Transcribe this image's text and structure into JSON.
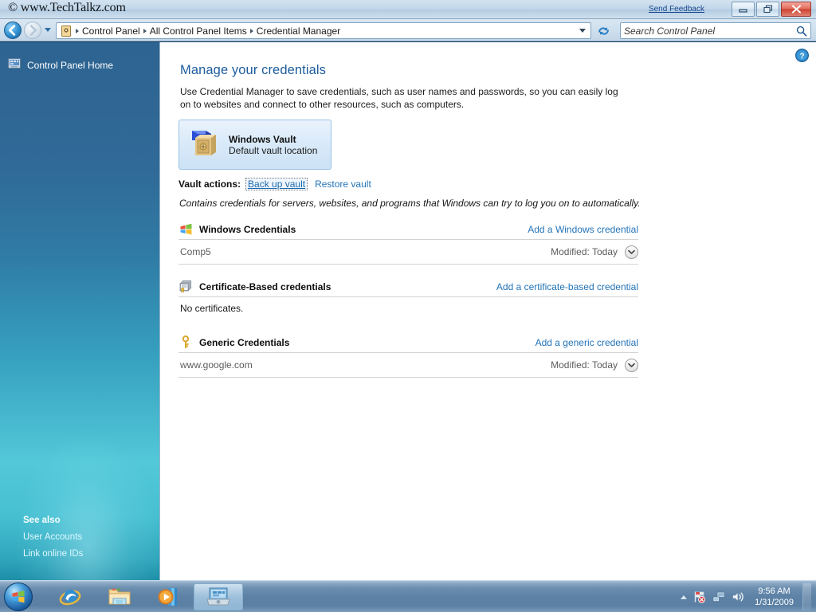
{
  "titlebar": {
    "watermark": "© www.TechTalkz.com",
    "feedback_label": "Send Feedback",
    "minimize_label": "Minimize",
    "restore_label": "Restore Down",
    "close_label": "Close"
  },
  "navbar": {
    "back_label": "Back",
    "forward_label": "Forward",
    "recent_pages_label": "Recent pages",
    "breadcrumbs": [
      {
        "label": "Control Panel"
      },
      {
        "label": "All Control Panel Items"
      },
      {
        "label": "Credential Manager"
      }
    ],
    "address_dropdown_label": "Previous locations",
    "refresh_label": "Refresh",
    "search_placeholder": "Search Control Panel",
    "search_value": ""
  },
  "sidebar": {
    "home_label": "Control Panel Home",
    "see_also_title": "See also",
    "see_also_links": [
      {
        "label": "User Accounts"
      },
      {
        "label": "Link online IDs"
      }
    ]
  },
  "content": {
    "help_label": "Help",
    "title": "Manage your credentials",
    "description": "Use Credential Manager to save credentials, such as user names and passwords, so you can easily log on to websites and connect to other resources, such as computers.",
    "vault": {
      "name": "Windows Vault",
      "subtitle": "Default vault location",
      "actions_label": "Vault actions:",
      "backup_label": "Back up vault",
      "restore_label": "Restore vault",
      "note": "Contains credentials for servers, websites, and programs that Windows can try to log you on to automatically."
    },
    "sections": [
      {
        "icon": "windows-flag-icon",
        "title": "Windows Credentials",
        "action": "Add a Windows credential",
        "rows": [
          {
            "name": "Comp5",
            "modified_label": "Modified:",
            "modified_value": "Today"
          }
        ],
        "empty_text": ""
      },
      {
        "icon": "certificate-icon",
        "title": "Certificate-Based credentials",
        "action": "Add a certificate-based credential",
        "rows": [],
        "empty_text": "No certificates."
      },
      {
        "icon": "key-icon",
        "title": "Generic Credentials",
        "action": "Add a generic credential",
        "rows": [
          {
            "name": "www.google.com",
            "modified_label": "Modified:",
            "modified_value": "Today"
          }
        ],
        "empty_text": ""
      }
    ]
  },
  "taskbar": {
    "start_label": "Start",
    "items": [
      {
        "name": "internet-explorer-icon",
        "label": "Internet Explorer"
      },
      {
        "name": "windows-explorer-icon",
        "label": "Windows Explorer"
      },
      {
        "name": "media-player-icon",
        "label": "Windows Media Player"
      }
    ],
    "active_window_label": "Credential Manager",
    "tray": {
      "overflow_label": "Show hidden icons",
      "action_center_label": "Action Center",
      "network_label": "Network",
      "volume_label": "Volume",
      "time": "9:56 AM",
      "date": "1/31/2009",
      "show_desktop_label": "Show desktop"
    }
  },
  "colors": {
    "accent_link": "#2374b8",
    "title_text": "#1c5c9e",
    "sidebar_top": "#2d6491",
    "sidebar_bottom": "#1d8fa8",
    "close_button": "#cd4433"
  }
}
